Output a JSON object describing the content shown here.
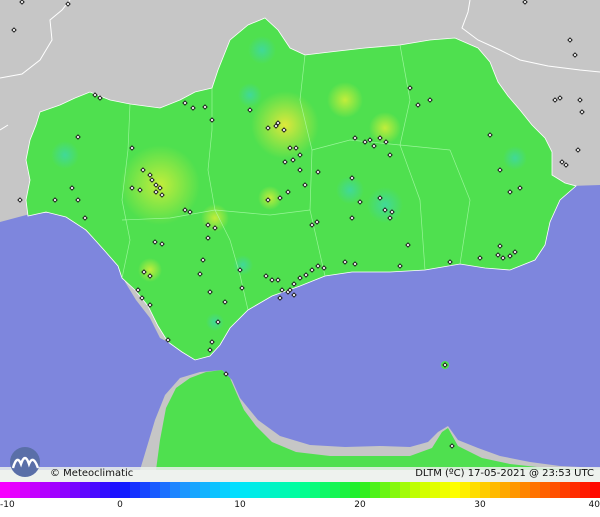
{
  "map": {
    "title": "DLTM (ºC) 17-05-2021 @ 23:53 UTC",
    "brand": "© Meteoclimatic",
    "brand_logo_icon": "meteoclimatic-logo-icon",
    "station_marker_icon": "station-diamond-icon",
    "colors": {
      "sea": "#7e86dd",
      "land_outside": "#c6c6c6",
      "region_base": "#4fe04f",
      "border": "#ffffff",
      "station_marker": "#111111"
    },
    "colorbar": {
      "min": -10,
      "max": 40,
      "tick_labels": [
        "-10",
        "0",
        "10",
        "20",
        "30",
        "40"
      ],
      "tick_values": [
        -10,
        0,
        10,
        20,
        30,
        40
      ],
      "stops": [
        {
          "value": -10,
          "color": "#ff00ff"
        },
        {
          "value": -5,
          "color": "#9900ff"
        },
        {
          "value": 0,
          "color": "#1010ff"
        },
        {
          "value": 5,
          "color": "#1e90ff"
        },
        {
          "value": 10,
          "color": "#00e5ff"
        },
        {
          "value": 15,
          "color": "#00ff99"
        },
        {
          "value": 20,
          "color": "#22ee22"
        },
        {
          "value": 25,
          "color": "#ccff00"
        },
        {
          "value": 28,
          "color": "#ffff00"
        },
        {
          "value": 32,
          "color": "#ffaa00"
        },
        {
          "value": 36,
          "color": "#ff5500"
        },
        {
          "value": 40,
          "color": "#ff0000"
        }
      ]
    }
  }
}
